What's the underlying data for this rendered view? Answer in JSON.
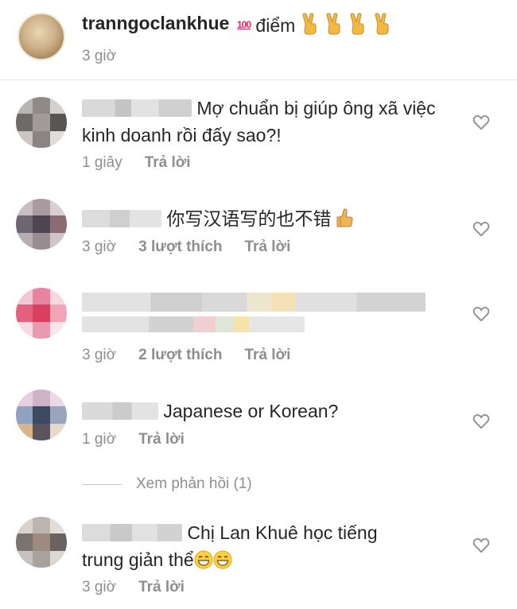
{
  "caption": {
    "username": "tranngoclankhue",
    "hundred_badge": "100",
    "text": "điểm",
    "time": "3 giờ"
  },
  "comments": [
    {
      "text": "Mợ chuẩn bị giúp ông xã việc kinh doanh rồi đấy sao?!",
      "time": "1 giây",
      "likes": "",
      "reply": "Trả lời"
    },
    {
      "text": "你写汉语写的也不错",
      "time": "3 giờ",
      "likes": "3 lượt thích",
      "reply": "Trả lời"
    },
    {
      "text": "",
      "time": "3 giờ",
      "likes": "2 lượt thích",
      "reply": "Trả lời"
    },
    {
      "text": "Japanese or Korean?",
      "time": "1 giờ",
      "likes": "",
      "reply": "Trả lời"
    },
    {
      "text_line1": "Chị Lan Khuê học tiếng",
      "text_line2": "trung giản thể",
      "time": "3 giờ",
      "likes": "",
      "reply": "Trả lời"
    }
  ],
  "view_replies": "Xem phản hồi (1)",
  "icons": {
    "like": "heart-outline-icon",
    "victory": "victory-hand-icon",
    "thumbs_up": "thumbs-up-icon",
    "grin": "grinning-face-icon"
  },
  "colors": {
    "text": "#262626",
    "secondary": "#8e8e8e",
    "divider": "#e6e6e6"
  }
}
